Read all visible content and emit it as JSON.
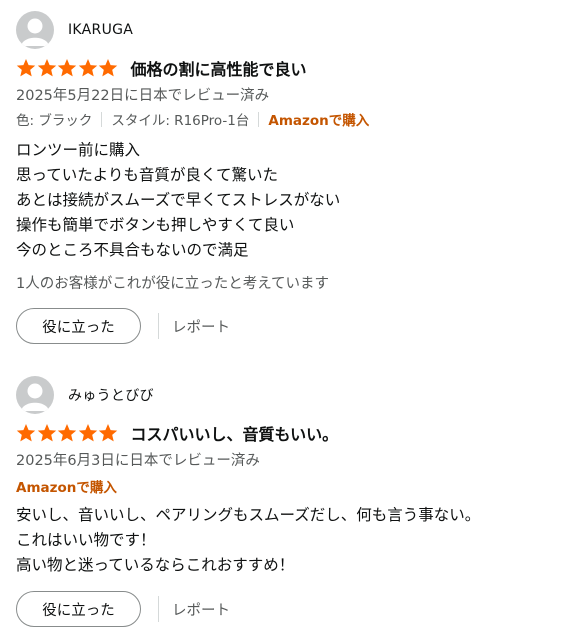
{
  "reviews": [
    {
      "username": "IKARUGA",
      "rating": 5,
      "title": "価格の割に高性能で良い",
      "date": "2025年5月22日に日本でレビュー済み",
      "variant_color": "色: ブラック",
      "variant_style": "スタイル: R16Pro-1台",
      "verified": "Amazonで購入",
      "body": [
        "ロンツー前に購入",
        "思っていたよりも音質が良くて驚いた",
        "あとは接続がスムーズで早くてストレスがない",
        "操作も簡単でボタンも押しやすくて良い",
        "今のところ不具合もないので満足"
      ],
      "helpful_text": "1人のお客様がこれが役に立ったと考えています",
      "helpful_button": "役に立った",
      "report": "レポート"
    },
    {
      "username": "みゅうとびび",
      "rating": 5,
      "title": "コスパいいし、音質もいい。",
      "date": "2025年6月3日に日本でレビュー済み",
      "verified": "Amazonで購入",
      "body": [
        "安いし、音いいし、ペアリングもスムーズだし、何も言う事ない。",
        "これはいい物です！",
        "高い物と迷っているならこれおすすめ！"
      ],
      "helpful_button": "役に立った",
      "report": "レポート"
    }
  ],
  "colors": {
    "star": "#ff6a00",
    "verified": "#c45500",
    "muted": "#565959",
    "text": "#0f1111"
  },
  "icons": {
    "avatar": "default-user-avatar-icon",
    "star": "star-icon"
  }
}
